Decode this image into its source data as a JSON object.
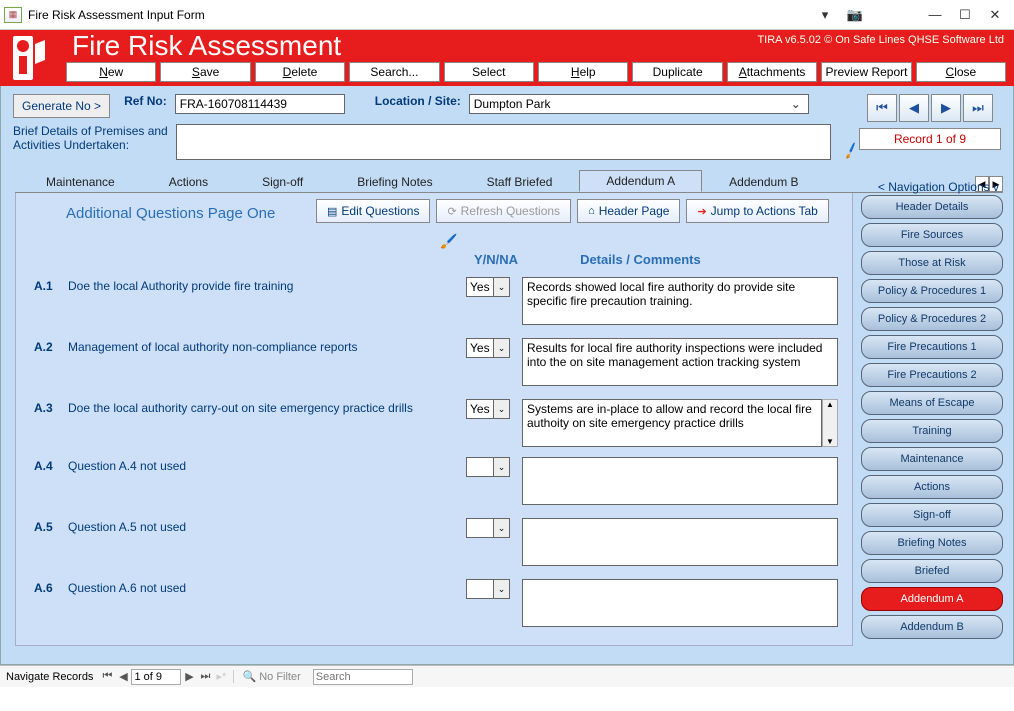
{
  "window": {
    "title": "Fire Risk Assessment Input Form"
  },
  "header": {
    "big_title": "Fire Risk Assessment",
    "version": "TIRA v6.5.02 © On Safe Lines QHSE Software Ltd",
    "menu": [
      "New",
      "Save",
      "Delete",
      "Search...",
      "Select",
      "Help",
      "Duplicate",
      "Attachments",
      "Preview Report",
      "Close"
    ],
    "menu_ul": [
      "N",
      "S",
      "D",
      "",
      "",
      "H",
      "",
      "A",
      "",
      "C"
    ]
  },
  "ref": {
    "gen_btn": "Generate No >",
    "ref_label": "Ref No:",
    "ref_value": "FRA-160708114439",
    "site_label": "Location / Site:",
    "site_value": "Dumpton Park",
    "brief_label": "Brief Details of Premises and Activities Undertaken:",
    "brief_value": ""
  },
  "nav": {
    "record": "Record 1 of 9",
    "options_label": "< Navigation Options v"
  },
  "tabs": [
    "Maintenance",
    "Actions",
    "Sign-off",
    "Briefing Notes",
    "Staff Briefed",
    "Addendum A",
    "Addendum B"
  ],
  "tab_selected": 5,
  "panel": {
    "title": "Additional Questions Page One",
    "buttons": {
      "edit": "Edit Questions",
      "refresh": "Refresh Questions",
      "header": "Header Page",
      "jump": "Jump to Actions Tab"
    },
    "col_yn": "Y/N/NA",
    "col_det": "Details / Comments",
    "rows": [
      {
        "num": "A.1",
        "q": "Doe the local Authority provide fire training",
        "yn": "Yes",
        "c": "Records showed local fire authority do provide site specific fire precaution training."
      },
      {
        "num": "A.2",
        "q": "Management of local authority non-compliance reports",
        "yn": "Yes",
        "c": "Results for local fire authority inspections were included into the on site management action tracking system"
      },
      {
        "num": "A.3",
        "q": "Doe the local authority carry-out on site emergency practice drills",
        "yn": "Yes",
        "c": "Systems are in-place to allow and record the local fire authoity on site emergency practice drills"
      },
      {
        "num": "A.4",
        "q": "Question A.4 not used",
        "yn": "",
        "c": ""
      },
      {
        "num": "A.5",
        "q": "Question A.5 not used",
        "yn": "",
        "c": ""
      },
      {
        "num": "A.6",
        "q": "Question A.6 not used",
        "yn": "",
        "c": ""
      }
    ]
  },
  "sidenav": [
    "Header Details",
    "Fire Sources",
    "Those at Risk",
    "Policy & Procedures 1",
    "Policy & Procedures 2",
    "Fire Precautions 1",
    "Fire Precautions 2",
    "Means of Escape",
    "Training",
    "Maintenance",
    "Actions",
    "Sign-off",
    "Briefing Notes",
    "Briefed",
    "Addendum A",
    "Addendum B"
  ],
  "sidenav_active": 14,
  "status": {
    "label": "Navigate Records",
    "page": "1 of 9",
    "filter": "No Filter",
    "search_ph": "Search"
  }
}
